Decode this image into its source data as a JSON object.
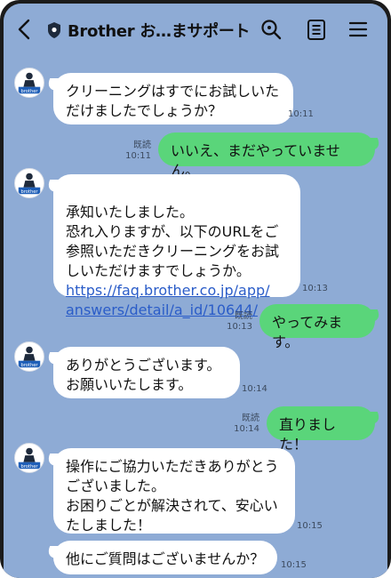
{
  "header": {
    "title": "Brother お…まサポート",
    "icons": [
      "back-icon",
      "shield-icon",
      "search-icon",
      "notes-icon",
      "menu-icon"
    ]
  },
  "brand": {
    "avatar_text": "brother",
    "link_color": "#2a5cc8",
    "outgoing_color": "#5ad57a",
    "background_color": "#8eabd5"
  },
  "messages": [
    {
      "from": "bot",
      "text": "クリーニングはすでにお試しいた\nだけましたでしょうか？",
      "time": "10:11"
    },
    {
      "from": "user",
      "text": "いいえ、まだやっていません。",
      "read": "既読",
      "time": "10:11"
    },
    {
      "from": "bot",
      "text": "承知いたしました。\n恐れ入りますが、以下のURLをご\n参照いただきクリーニングをお試\nしいただけますでしょうか。",
      "link": "https://faq.brother.co.jp/app/\nanswers/detail/a_id/10644/",
      "time": "10:13"
    },
    {
      "from": "user",
      "text": "やってみます。",
      "read": "既読",
      "time": "10:13"
    },
    {
      "from": "bot",
      "text": "ありがとうございます。\nお願いいたします。",
      "time": "10:14"
    },
    {
      "from": "user",
      "text": "直りました！",
      "read": "既読",
      "time": "10:14"
    },
    {
      "from": "bot",
      "text": "操作にご協力いただきありがとう\nございました。\nお困りごとが解決されて、安心い\nたしました！",
      "time": "10:15"
    },
    {
      "from": "bot",
      "text": "他にご質問はございませんか？",
      "time": "10:15"
    }
  ]
}
